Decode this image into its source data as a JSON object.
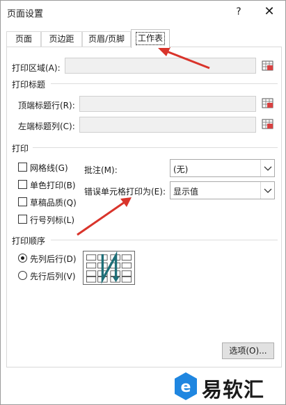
{
  "titlebar": {
    "title": "页面设置",
    "help_label": "?",
    "close_label": "✕"
  },
  "tabs": [
    {
      "label": "页面"
    },
    {
      "label": "页边距"
    },
    {
      "label": "页眉/页脚"
    },
    {
      "label": "工作表",
      "active": true
    }
  ],
  "print_area": {
    "label": "打印区域(A):",
    "value": ""
  },
  "print_titles": {
    "group_label": "打印标题",
    "rows_label": "顶端标题行(R):",
    "rows_value": "",
    "cols_label": "左端标题列(C):",
    "cols_value": ""
  },
  "print": {
    "group_label": "打印",
    "gridlines": {
      "label": "网格线(G)",
      "checked": false
    },
    "black_white": {
      "label": "单色打印(B)",
      "checked": false
    },
    "draft": {
      "label": "草稿品质(Q)",
      "checked": false
    },
    "row_col_headings": {
      "label": "行号列标(L)",
      "checked": false
    },
    "comments_label": "批注(M):",
    "comments_value": "(无)",
    "errors_label": "错误单元格打印为(E):",
    "errors_value": "显示值"
  },
  "page_order": {
    "group_label": "打印顺序",
    "down_then_over": {
      "label": "先列后行(D)",
      "checked": true
    },
    "over_then_down": {
      "label": "先行后列(V)",
      "checked": false
    }
  },
  "buttons": {
    "options_label": "选项(O)..."
  },
  "watermark": {
    "text": "易软汇"
  },
  "colors": {
    "arrow": "#d9342b",
    "order_arrow": "#1f6f78",
    "logo_blue": "#1f86e0"
  },
  "icons": {
    "collapse": "collapse-dialog-icon",
    "chevron": "chevron-down-icon",
    "logo": "e-logo-icon",
    "annotation": "red-arrow-annotation"
  }
}
